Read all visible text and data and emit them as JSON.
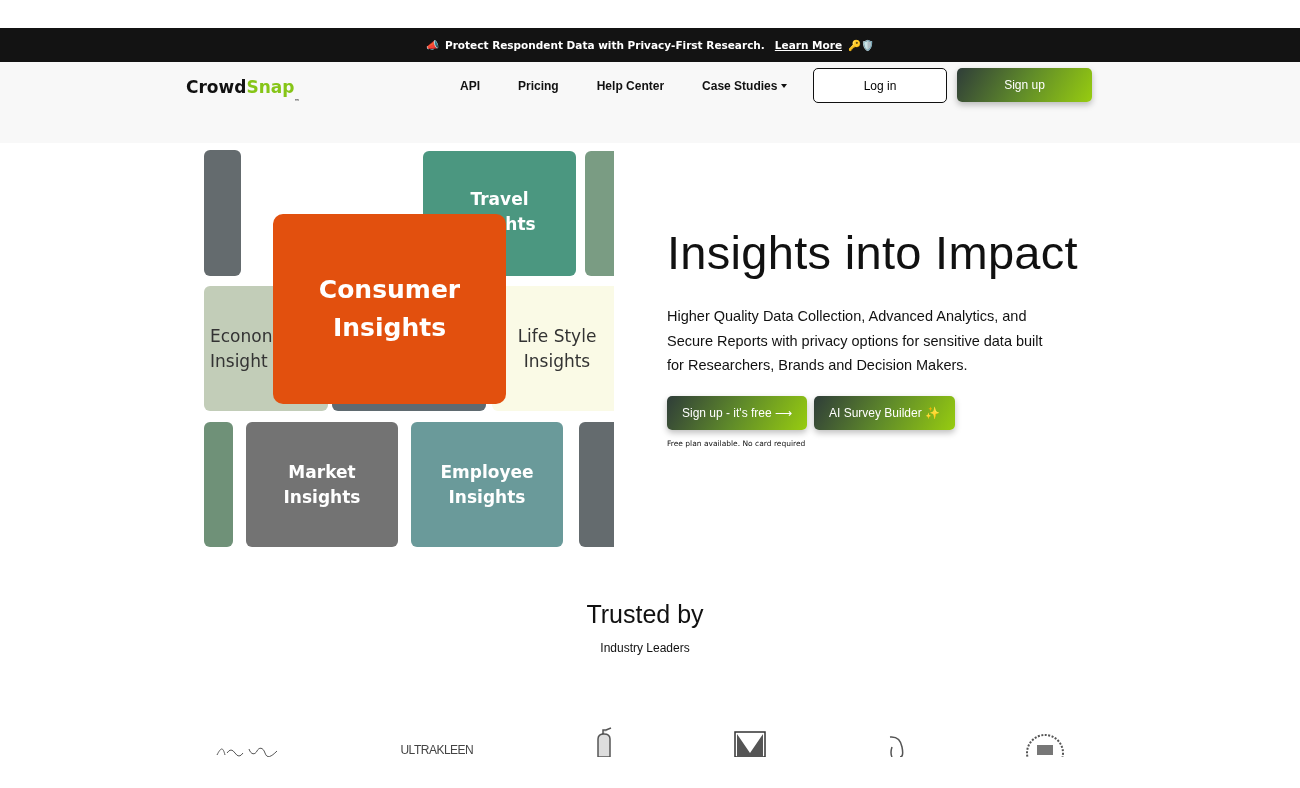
{
  "announcement": {
    "icon": "📣",
    "text": "Protect Respondent Data with Privacy-First Research.",
    "link": "Learn More",
    "trailing": "🔑🛡️"
  },
  "nav": {
    "logo": {
      "part1": "Crowd",
      "part2": "Snap",
      "mark": "™"
    },
    "links": [
      {
        "label": "API",
        "dropdown": false
      },
      {
        "label": "Pricing",
        "dropdown": false
      },
      {
        "label": "Help Center",
        "dropdown": false
      },
      {
        "label": "Case Studies",
        "dropdown": true
      }
    ],
    "login": "Log in",
    "signup": "Sign up"
  },
  "collage": [
    {
      "kind": "tile",
      "color": "#646b6e"
    },
    {
      "kind": "tile",
      "color": "#4b9780",
      "lines": [
        "Travel",
        "hts"
      ]
    },
    {
      "kind": "tile",
      "color": "#7a9c83"
    },
    {
      "kind": "tile",
      "color": "#5f6a70"
    },
    {
      "kind": "tile",
      "color": "#c2cdb8",
      "lines": [
        "Econon",
        "Insight"
      ]
    },
    {
      "kind": "tile",
      "color": "#fafae6",
      "lines": [
        "Life Style",
        "Insights"
      ]
    },
    {
      "kind": "featured",
      "color": "#e2500e",
      "lines": [
        "Consumer",
        "Insights"
      ]
    },
    {
      "kind": "tile",
      "color": "#6f9178"
    },
    {
      "kind": "tile",
      "color": "#737373",
      "lines": [
        "Market",
        "Insights"
      ]
    },
    {
      "kind": "tile",
      "color": "#6a9a9a",
      "lines": [
        "Employee",
        "Insights"
      ]
    },
    {
      "kind": "tile",
      "color": "#646b6e"
    }
  ],
  "hero": {
    "title": "Insights into Impact",
    "body": "Higher Quality Data Collection, Advanced Analytics, and Secure Reports with privacy options for sensitive data built for Researchers, Brands and Decision Makers.",
    "buttons": [
      "Sign up - it's free ⟶",
      "AI Survey Builder ✨"
    ],
    "note": "Free plan available. No card required"
  },
  "trusted": {
    "title": "Trusted by",
    "subtitle": "Industry Leaders",
    "logos": [
      {
        "kind": "script"
      },
      {
        "kind": "wordmark",
        "text": "ULTRAKLEEN"
      },
      {
        "kind": "extinguisher"
      },
      {
        "kind": "m-box"
      },
      {
        "kind": "hook"
      },
      {
        "kind": "seal"
      }
    ]
  }
}
